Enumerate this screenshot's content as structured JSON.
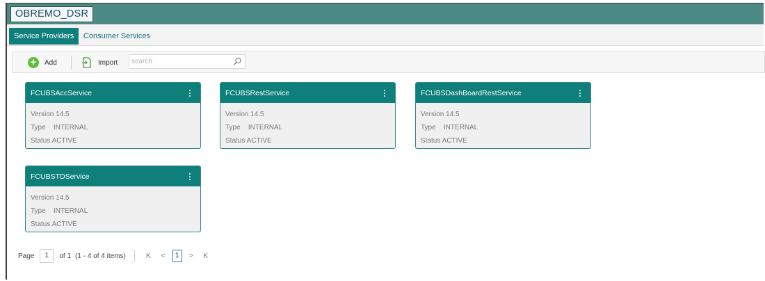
{
  "app": {
    "title": "OBREMO_DSR"
  },
  "tabs": [
    {
      "label": "Service Providers",
      "active": true
    },
    {
      "label": "Consumer Services",
      "active": false
    }
  ],
  "toolbar": {
    "add_label": "Add",
    "import_label": "Import",
    "search_placeholder": "search"
  },
  "cards": [
    {
      "name": "FCUBSAccService",
      "version_label": "Version",
      "version": "14.5",
      "type_label": "Type",
      "type": "INTERNAL",
      "status_label": "Status",
      "status": "ACTIVE"
    },
    {
      "name": "FCUBSRestService",
      "version_label": "Version",
      "version": "14.5",
      "type_label": "Type",
      "type": "INTERNAL",
      "status_label": "Status",
      "status": "ACTIVE"
    },
    {
      "name": "FCUBSDashBoardRestService",
      "version_label": "Version",
      "version": "14.5",
      "type_label": "Type",
      "type": "INTERNAL",
      "status_label": "Status",
      "status": "ACTIVE"
    },
    {
      "name": "FCUBSTDService",
      "version_label": "Version",
      "version": "14.5",
      "type_label": "Type",
      "type": "INTERNAL",
      "status_label": "Status",
      "status": "ACTIVE"
    }
  ],
  "pagination": {
    "page_label": "Page",
    "page_value": "1",
    "of_label": "of 1",
    "items_label": "(1 - 4 of 4 items)",
    "current_page": "1",
    "first_icon": "K",
    "prev_icon": "<",
    "next_icon": ">",
    "last_icon": "K"
  },
  "colors": {
    "header": "#4d8a85",
    "accent": "#0f7f7b",
    "add_icon": "#5ebd3e"
  }
}
